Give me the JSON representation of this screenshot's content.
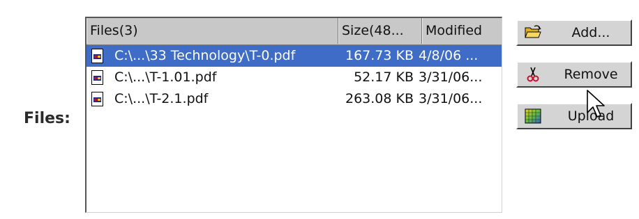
{
  "form": {
    "label": "Files:"
  },
  "file_list": {
    "columns": {
      "name": "Files(3)",
      "size": "Size(48...",
      "modified": "Modified"
    },
    "rows": [
      {
        "name": "C:\\...\\33 Technology\\T-0.pdf",
        "size": "167.73 KB",
        "modified": "4/8/06 ...",
        "selected": true,
        "icon": "pdf-file-icon"
      },
      {
        "name": "C:\\...\\T-1.01.pdf",
        "size": "52.17 KB",
        "modified": "3/31/06...",
        "selected": false,
        "icon": "pdf-file-icon"
      },
      {
        "name": "C:\\...\\T-2.1.pdf",
        "size": "263.08 KB",
        "modified": "3/31/06...",
        "selected": false,
        "icon": "pdf-file-icon"
      }
    ]
  },
  "buttons": {
    "add": {
      "label": "Add...",
      "icon": "open-folder-icon"
    },
    "remove": {
      "label": "Remove",
      "icon": "scissors-icon"
    },
    "upload": {
      "label": "Upload",
      "icon": "upload-grid-icon"
    }
  },
  "colors": {
    "selection": "#3e6cc6",
    "header": "#c8c8c8",
    "button_face": "#d4d4d4"
  }
}
